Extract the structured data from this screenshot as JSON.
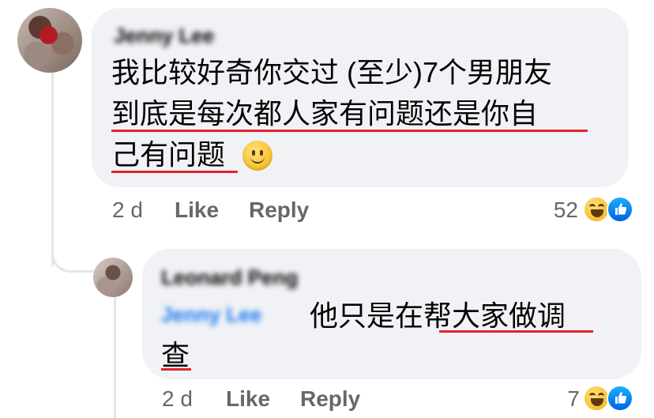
{
  "comments": [
    {
      "author": "Jenny Lee",
      "lines": [
        "我比较好奇你交过 (至少)7个男朋友",
        "到底是每次都人家有问题还是你自",
        "己有问题"
      ],
      "time": "2 d",
      "like_label": "Like",
      "reply_label": "Reply",
      "reaction_count": "52",
      "reactions": [
        "haha-icon",
        "like-icon"
      ]
    },
    {
      "author": "Leonard Peng",
      "mention": "Jenny Lee",
      "lines": [
        "他只是在帮大家做调",
        "查"
      ],
      "time": "2 d",
      "like_label": "Like",
      "reply_label": "Reply",
      "reaction_count": "7",
      "reactions": [
        "haha-icon",
        "like-icon"
      ]
    }
  ],
  "colors": {
    "bubble_bg": "#f0f2f5",
    "underline": "#e0232e",
    "meta_text": "#65676b",
    "mention": "#1877f2"
  }
}
